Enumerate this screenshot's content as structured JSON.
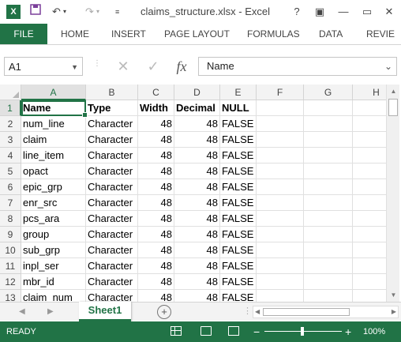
{
  "app": {
    "logo_text": "X",
    "title": "claims_structure.xlsx - Excel",
    "window_controls": [
      "?",
      "▣",
      "—",
      "✕"
    ]
  },
  "ribbon": {
    "file_label": "FILE",
    "tabs": [
      "HOME",
      "INSERT",
      "PAGE LAYOUT",
      "FORMULAS",
      "DATA",
      "REVIE"
    ]
  },
  "formula_bar": {
    "name_box": "A1",
    "fx_label": "fx",
    "content": "Name"
  },
  "columns": [
    "A",
    "B",
    "C",
    "D",
    "E",
    "F",
    "G",
    "H"
  ],
  "selected_column": "A",
  "rows": [
    [
      "Name",
      "Type",
      "Width",
      "Decimal",
      "NULL"
    ],
    [
      "num_line",
      "Character",
      "48",
      "48",
      "FALSE"
    ],
    [
      "claim",
      "Character",
      "48",
      "48",
      "FALSE"
    ],
    [
      "line_item",
      "Character",
      "48",
      "48",
      "FALSE"
    ],
    [
      "opact",
      "Character",
      "48",
      "48",
      "FALSE"
    ],
    [
      "epic_grp",
      "Character",
      "48",
      "48",
      "FALSE"
    ],
    [
      "enr_src",
      "Character",
      "48",
      "48",
      "FALSE"
    ],
    [
      "pcs_ara",
      "Character",
      "48",
      "48",
      "FALSE"
    ],
    [
      "group",
      "Character",
      "48",
      "48",
      "FALSE"
    ],
    [
      "sub_grp",
      "Character",
      "48",
      "48",
      "FALSE"
    ],
    [
      "inpl_ser",
      "Character",
      "48",
      "48",
      "FALSE"
    ],
    [
      "mbr_id",
      "Character",
      "48",
      "48",
      "FALSE"
    ],
    [
      "claim_num",
      "Character",
      "48",
      "48",
      "FALSE"
    ]
  ],
  "sheets": {
    "active": "Sheet1",
    "add_label": "+"
  },
  "status": {
    "text": "READY",
    "zoom": "100%"
  },
  "colors": {
    "accent": "#217346"
  }
}
